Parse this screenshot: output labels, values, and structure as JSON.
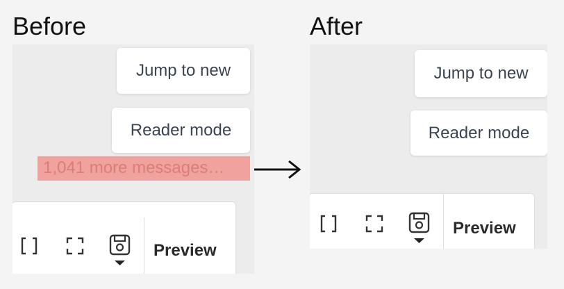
{
  "before": {
    "heading": "Before",
    "jump_button": "Jump to new",
    "reader_button": "Reader mode",
    "more_messages": "1,041 more messages…",
    "toolbar": {
      "icons": [
        "bracket-icon",
        "fullscreen-icon",
        "save-icon"
      ],
      "preview_label": "Preview"
    }
  },
  "after": {
    "heading": "After",
    "jump_button": "Jump to new",
    "reader_button": "Reader mode",
    "toolbar": {
      "icons": [
        "bracket-icon",
        "fullscreen-icon",
        "save-icon"
      ],
      "preview_label": "Preview"
    }
  },
  "colors": {
    "highlight": "#f0a39e",
    "highlight_text": "#dd7c78",
    "panel_bg": "#ececec",
    "button_text": "#3b4452"
  }
}
